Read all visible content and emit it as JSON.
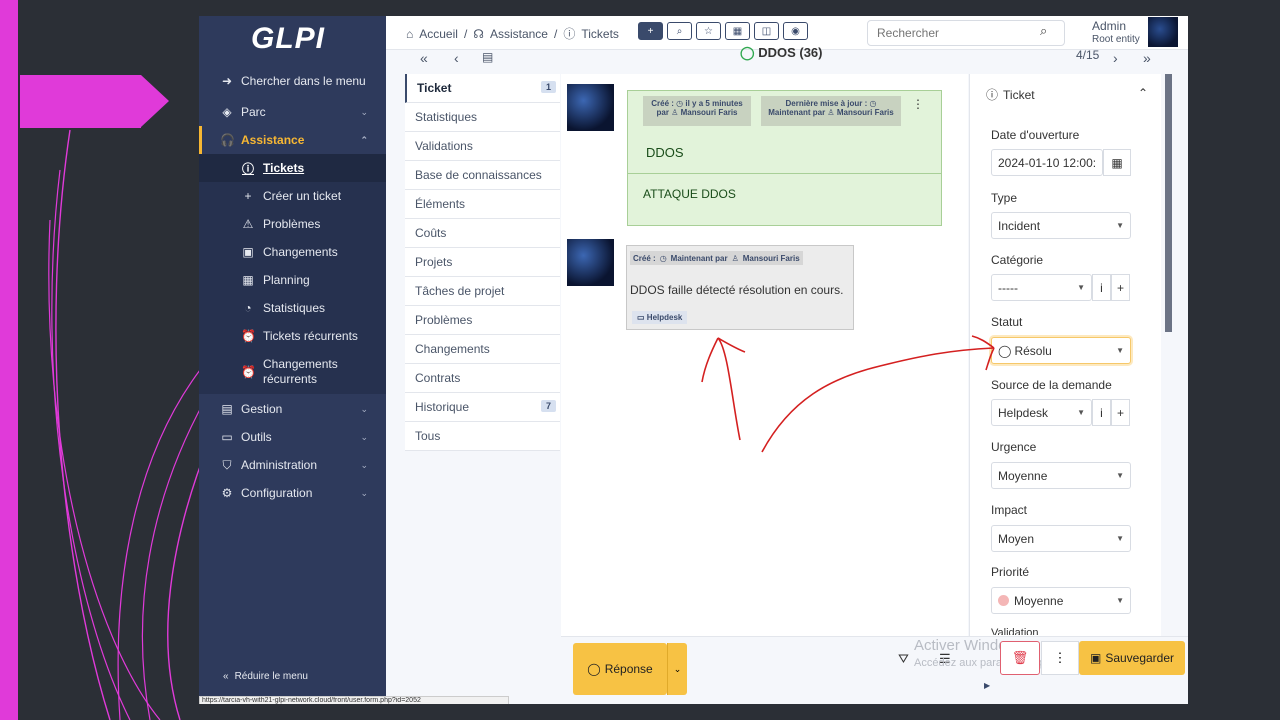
{
  "app": {
    "logo": "GLPI"
  },
  "sidebar": {
    "search_menu": "Chercher dans le menu",
    "items": [
      {
        "label": "Parc",
        "icon": "cube-icon"
      },
      {
        "label": "Assistance",
        "icon": "headset-icon"
      },
      {
        "label": "Gestion",
        "icon": "wallet-icon"
      },
      {
        "label": "Outils",
        "icon": "briefcase-icon"
      },
      {
        "label": "Administration",
        "icon": "shield-icon"
      },
      {
        "label": "Configuration",
        "icon": "gear-icon"
      }
    ],
    "sub_items": [
      {
        "label": "Tickets"
      },
      {
        "label": "Créer un ticket"
      },
      {
        "label": "Problèmes"
      },
      {
        "label": "Changements"
      },
      {
        "label": "Planning"
      },
      {
        "label": "Statistiques"
      },
      {
        "label": "Tickets récurrents"
      },
      {
        "label": "Changements",
        "label2": "récurrents"
      }
    ],
    "reduce": "Réduire le menu"
  },
  "status_url": "https://tarcia-vh-with21-glpi-network.cloud/front/user.form.php?id=2052",
  "header": {
    "breadcrumb": [
      "Accueil",
      "Assistance",
      "Tickets"
    ],
    "search_placeholder": "Rechercher",
    "user_name": "Admin",
    "user_entity": "Root entity"
  },
  "ticket_nav": {
    "title": "DDOS (36)",
    "position": "4/15"
  },
  "tabs": [
    {
      "label": "Ticket",
      "badge": "1"
    },
    {
      "label": "Statistiques"
    },
    {
      "label": "Validations"
    },
    {
      "label": "Base de connaissances"
    },
    {
      "label": "Éléments"
    },
    {
      "label": "Coûts"
    },
    {
      "label": "Projets"
    },
    {
      "label": "Tâches de projet"
    },
    {
      "label": "Problèmes"
    },
    {
      "label": "Changements"
    },
    {
      "label": "Contrats"
    },
    {
      "label": "Historique",
      "badge": "7"
    },
    {
      "label": "Tous"
    }
  ],
  "timeline": {
    "card1": {
      "created_label": "Créé :",
      "created_when": "il y a 5 minutes",
      "by_label": "par",
      "author": "Mansouri Faris",
      "updated_label": "Dernière mise à jour :",
      "updated_when": "Maintenant",
      "updated_author": "Mansouri Faris",
      "title": "DDOS",
      "body": "ATTAQUE DDOS"
    },
    "card2": {
      "created_label": "Créé :",
      "created_when": "Maintenant par",
      "author": "Mansouri Faris",
      "body": "DDOS faille détecté résolution en cours.",
      "source": "Helpdesk"
    }
  },
  "panel": {
    "heading": "Ticket",
    "fields": {
      "opening_date_label": "Date d'ouverture",
      "opening_date": "2024-01-10 12:00:",
      "type_label": "Type",
      "type": "Incident",
      "category_label": "Catégorie",
      "category": "-----",
      "status_label": "Statut",
      "status": "Résolu",
      "source_label": "Source de la demande",
      "source": "Helpdesk",
      "urgency_label": "Urgence",
      "urgency": "Moyenne",
      "impact_label": "Impact",
      "impact": "Moyen",
      "priority_label": "Priorité",
      "priority": "Moyenne",
      "validation_label": "Validation"
    }
  },
  "bottom": {
    "reply": "Réponse",
    "save": "Sauvegarder",
    "activate_title": "Activer Windows",
    "activate_sub": "Accédez aux paramètres pour activer Windows."
  },
  "colors": {
    "accent": "#f7c244",
    "sidebar": "#2e3a5c",
    "slide_accent": "#e03ad9",
    "annotation": "#d42020"
  }
}
